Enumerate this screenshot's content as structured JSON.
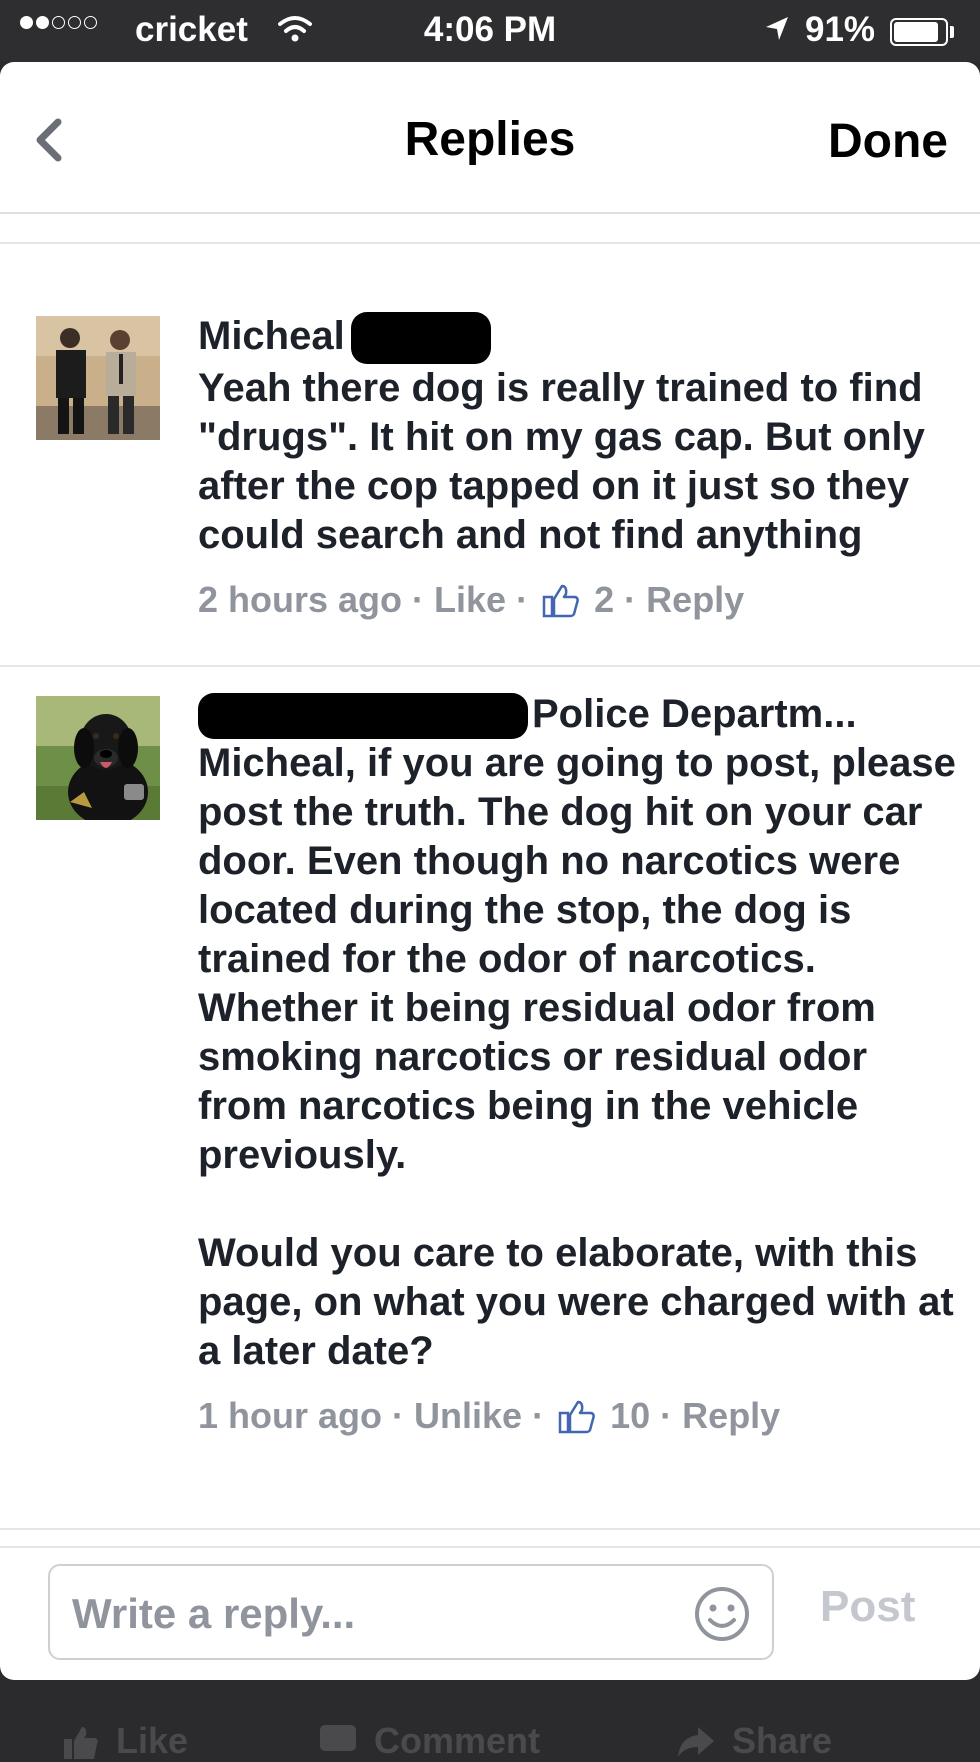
{
  "status_bar": {
    "carrier": "cricket",
    "time": "4:06 PM",
    "battery": "91%",
    "signal_bars_filled": 2,
    "signal_bars_total": 5
  },
  "nav": {
    "title": "Replies",
    "done_label": "Done",
    "back_icon": "chevron-left-icon"
  },
  "comments": [
    {
      "author": "Micheal",
      "author_redacted": true,
      "text": [
        "Yeah there dog is really trained to find \"drugs\". It hit on my gas cap. But only after the cop tapped on it just so they could search and not find anything"
      ],
      "time": "2 hours ago",
      "like_action": "Like",
      "likes": "2",
      "reply_action": "Reply"
    },
    {
      "author": "Police Departm...",
      "author_redacted": true,
      "text": [
        "Micheal, if you are going to post, please post the truth.  The dog hit on your car door.  Even though no narcotics were located during the stop, the dog is trained for the odor of narcotics.  Whether it being residual odor from smoking narcotics or residual odor from narcotics being in the vehicle previously.",
        "Would you care to elaborate, with this page, on what you were charged with at a later date?"
      ],
      "time": "1 hour ago",
      "like_action": "Unlike",
      "likes": "10",
      "reply_action": "Reply"
    }
  ],
  "composer": {
    "placeholder": "Write a reply...",
    "post_label": "Post",
    "emoji_icon": "smiley-icon"
  },
  "bottom_bar": {
    "items": [
      "Like",
      "Comment",
      "Share"
    ]
  },
  "colors": {
    "text": "#1d2129",
    "meta": "#90949c",
    "divider": "#e4e6eb",
    "post_disabled": "#c4c8ce",
    "status_bar": "#2e2e30"
  }
}
